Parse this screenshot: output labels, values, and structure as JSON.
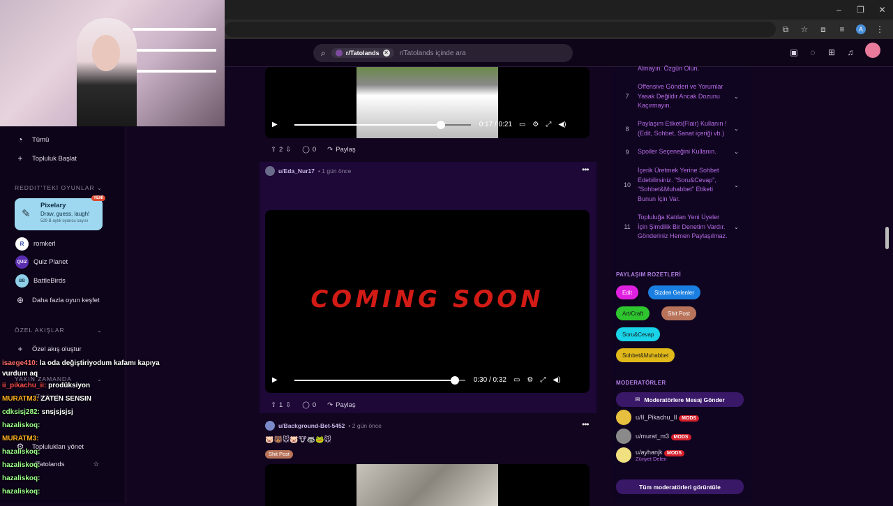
{
  "browser": {
    "window_controls": [
      "–",
      "❐",
      "✕"
    ],
    "profile_letter": "A"
  },
  "header": {
    "search_chip": "r/Tatolands",
    "search_placeholder": "r/Tatolands içinde ara"
  },
  "sidebar": {
    "items": [
      {
        "label": "Tümü",
        "icon": "chart-icon"
      },
      {
        "label": "Topluluk Başlat",
        "icon": "plus-icon"
      }
    ],
    "games_title": "REDDIT'TEKİ OYUNLAR",
    "pixelary": {
      "title": "Pixelary",
      "desc": "Draw, guess, laugh!",
      "users": "529 B aylık oyuncu sayısı",
      "badge": "YENİ"
    },
    "games": [
      {
        "label": "romkerl",
        "icon": "R"
      },
      {
        "label": "Quiz Planet",
        "icon": "QUIZ"
      },
      {
        "label": "BattleBirds",
        "icon": "BB"
      },
      {
        "label": "Daha fazla oyun keşfet",
        "icon": "gamepad-icon"
      }
    ],
    "feeds_title": "ÖZEL AKIŞLAR",
    "create_feed": "Özel akış oluştur",
    "recent_title": "YAKIN ZAMANDA",
    "recent_sub": "r/Tatolands",
    "communities_manage": "Toplulukları yönet",
    "community_item": "r/Tatolands"
  },
  "chat": [
    {
      "user": "isaege410:",
      "text": "la oda değiştiriyodum kafamı kapıya vurdum aq",
      "color": "#ff6b6b"
    },
    {
      "user": "ii_pikachu_ii:",
      "text": "prodüksiyon",
      "color": "#ff4d4d"
    },
    {
      "user": "MURATM3:",
      "text": "ZATEN SENSIN",
      "color": "#ffb020"
    },
    {
      "user": "cdksisj282:",
      "text": "snsjsjsjsj",
      "color": "#9dff8a"
    },
    {
      "user": "hazaliskoq:",
      "text": "",
      "color": "#9dff8a"
    },
    {
      "user": "MURATM3:",
      "text": "",
      "color": "#ffb020"
    },
    {
      "user": "hazaliskoq:",
      "text": "",
      "color": "#9dff8a"
    },
    {
      "user": "hazaliskoq:",
      "text": "",
      "color": "#9dff8a"
    },
    {
      "user": "hazaliskoq:",
      "text": "",
      "color": "#9dff8a"
    },
    {
      "user": "hazaliskoq:",
      "text": "",
      "color": "#9dff8a"
    }
  ],
  "posts": [
    {
      "time_display": "0:17 / 0:21",
      "progress": 0.83,
      "votes": "2",
      "comments": "0",
      "share": "Paylaş"
    },
    {
      "user": "u/Eda_Nur17",
      "age": "• 1 gün önce",
      "video_text": "COMING SOON",
      "time_display": "0:30 / 0:32",
      "progress": 0.94,
      "votes": "1",
      "comments": "0",
      "share": "Paylaş"
    },
    {
      "user": "u/Background-Bet-5452",
      "age": "• 2 gün önce",
      "flair": "Shit Post"
    }
  ],
  "rules": [
    {
      "num": "",
      "text": "Almayın. Özgün Olun."
    },
    {
      "num": "7",
      "text": "Offensive Gönderi ve Yorumlar Yasak Değildir Ancak Dozunu Kaçırmayın."
    },
    {
      "num": "8",
      "text": "Paylaşım Etiketi(Flair) Kullanın ! (Edit, Sohbet, Sanat içeriği vb.)"
    },
    {
      "num": "9",
      "text": "Spoiler Seçeneğini Kullanın."
    },
    {
      "num": "10",
      "text": "İçerik Üretmek Yerine Sohbet Edebilirsiniz. \"Soru&Cevap\", \"Sohbet&Muhabbet\" Etiketi Bunun İçin Var."
    },
    {
      "num": "11",
      "text": "Topluluğa Katılan Yeni Üyeler İçin Şimdilik Bir Denetim Vardır. Gönderiniz Hemen Paylaşılmaz."
    }
  ],
  "flairs_title": "PAYLAŞIM ROZETLERİ",
  "flairs": [
    {
      "label": "Edit",
      "color": "#e020e0"
    },
    {
      "label": "Sizden Gelenler",
      "color": "#1a7fe0"
    },
    {
      "label": "Art/Craft",
      "color": "#2ec52e"
    },
    {
      "label": "Shit Post",
      "color": "#b8735a"
    },
    {
      "label": "Soru&Cevap",
      "color": "#19d3e8"
    },
    {
      "label": "Sohbet&Muhabbet",
      "color": "#e0b81a"
    }
  ],
  "moderators_title": "MODERATÖRLER",
  "message_mods": "Moderatörlere Mesaj Gönder",
  "moderators": [
    {
      "name": "u/II_Pikachu_II",
      "tag": "MODS",
      "sub": ""
    },
    {
      "name": "u/murat_m3",
      "tag": "MODS",
      "sub": ""
    },
    {
      "name": "u/ayhanjk",
      "tag": "MODS",
      "sub": "Züriyet Delen"
    }
  ],
  "view_all_mods": "Tüm moderatörleri görüntüle"
}
